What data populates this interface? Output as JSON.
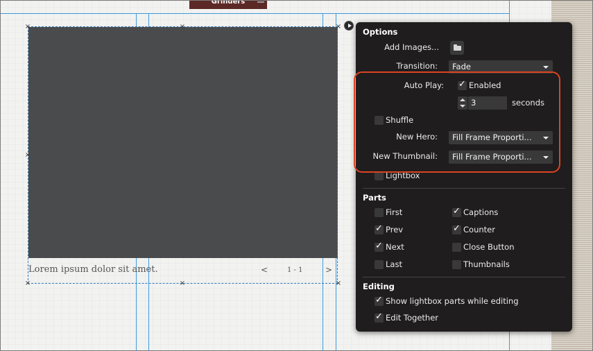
{
  "canvas": {
    "top_tab_label": "Grinders",
    "caption_text": "Lorem ipsum dolor sit amet.",
    "counter_text": "1 - 1",
    "prev_label": "<",
    "next_label": ">",
    "handle_glyph": "×",
    "play_button_icon": "play-icon"
  },
  "panel": {
    "options": {
      "title": "Options",
      "add_images_label": "Add Images...",
      "add_images_icon": "folder-icon",
      "transition_label": "Transition:",
      "transition_value": "Fade",
      "auto_play_label": "Auto Play:",
      "auto_play_enabled_label": "Enabled",
      "auto_play_enabled": true,
      "seconds_value": "3",
      "seconds_label": "seconds",
      "shuffle_label": "Shuffle",
      "shuffle_checked": false,
      "new_hero_label": "New Hero:",
      "new_hero_value": "Fill Frame Proporti...",
      "new_thumbnail_label": "New Thumbnail:",
      "new_thumbnail_value": "Fill Frame Proporti...",
      "lightbox_label": "Lightbox",
      "lightbox_checked": false
    },
    "parts": {
      "title": "Parts",
      "items": [
        {
          "label": "First",
          "checked": false
        },
        {
          "label": "Prev",
          "checked": true
        },
        {
          "label": "Next",
          "checked": true
        },
        {
          "label": "Last",
          "checked": false
        },
        {
          "label": "Captions",
          "checked": true
        },
        {
          "label": "Counter",
          "checked": true
        },
        {
          "label": "Close Button",
          "checked": false
        },
        {
          "label": "Thumbnails",
          "checked": false
        }
      ]
    },
    "editing": {
      "title": "Editing",
      "show_parts_label": "Show lightbox parts while editing",
      "show_parts_checked": true,
      "edit_together_label": "Edit Together",
      "edit_together_checked": true
    }
  },
  "colors": {
    "highlight": "#dd4422",
    "panel_bg": "#1f1d1e",
    "guide": "#3a9ad9",
    "hero_bg": "#4a4b4d"
  }
}
